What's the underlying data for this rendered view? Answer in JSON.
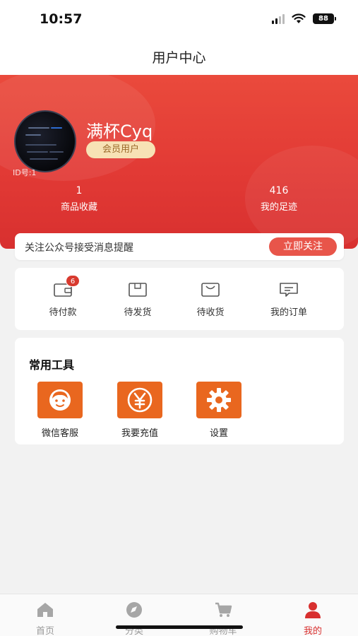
{
  "status": {
    "time": "10:57",
    "battery": "88",
    "icons": [
      "signal-icon",
      "wifi-icon",
      "battery-icon"
    ]
  },
  "header": {
    "title": "用户中心"
  },
  "profile": {
    "name": "满杯Cyq",
    "member_label": "会员用户",
    "id_text": "ID号:1"
  },
  "stats": [
    {
      "value": "1",
      "label": "商品收藏"
    },
    {
      "value": "416",
      "label": "我的足迹"
    }
  ],
  "follow": {
    "text": "关注公众号接受消息提醒",
    "button": "立即关注"
  },
  "orders": [
    {
      "label": "待付款",
      "icon": "wallet-icon",
      "badge": "6"
    },
    {
      "label": "待发货",
      "icon": "box-icon"
    },
    {
      "label": "待收货",
      "icon": "package-icon"
    },
    {
      "label": "我的订单",
      "icon": "message-icon"
    }
  ],
  "tools": {
    "title": "常用工具",
    "items": [
      {
        "label": "微信客服",
        "icon": "customer-service-icon"
      },
      {
        "label": "我要充值",
        "icon": "yen-icon"
      },
      {
        "label": "设置",
        "icon": "gear-icon"
      }
    ]
  },
  "tabbar": [
    {
      "label": "首页",
      "icon": "home-icon"
    },
    {
      "label": "分类",
      "icon": "compass-icon"
    },
    {
      "label": "购物车",
      "icon": "cart-icon"
    },
    {
      "label": "我的",
      "icon": "user-icon",
      "active": true
    }
  ],
  "colors": {
    "brand_red": "#e23a35",
    "badge_gold": "#f7e2b5",
    "tool_orange": "#e9671f",
    "follow_button": "#e8554a"
  }
}
